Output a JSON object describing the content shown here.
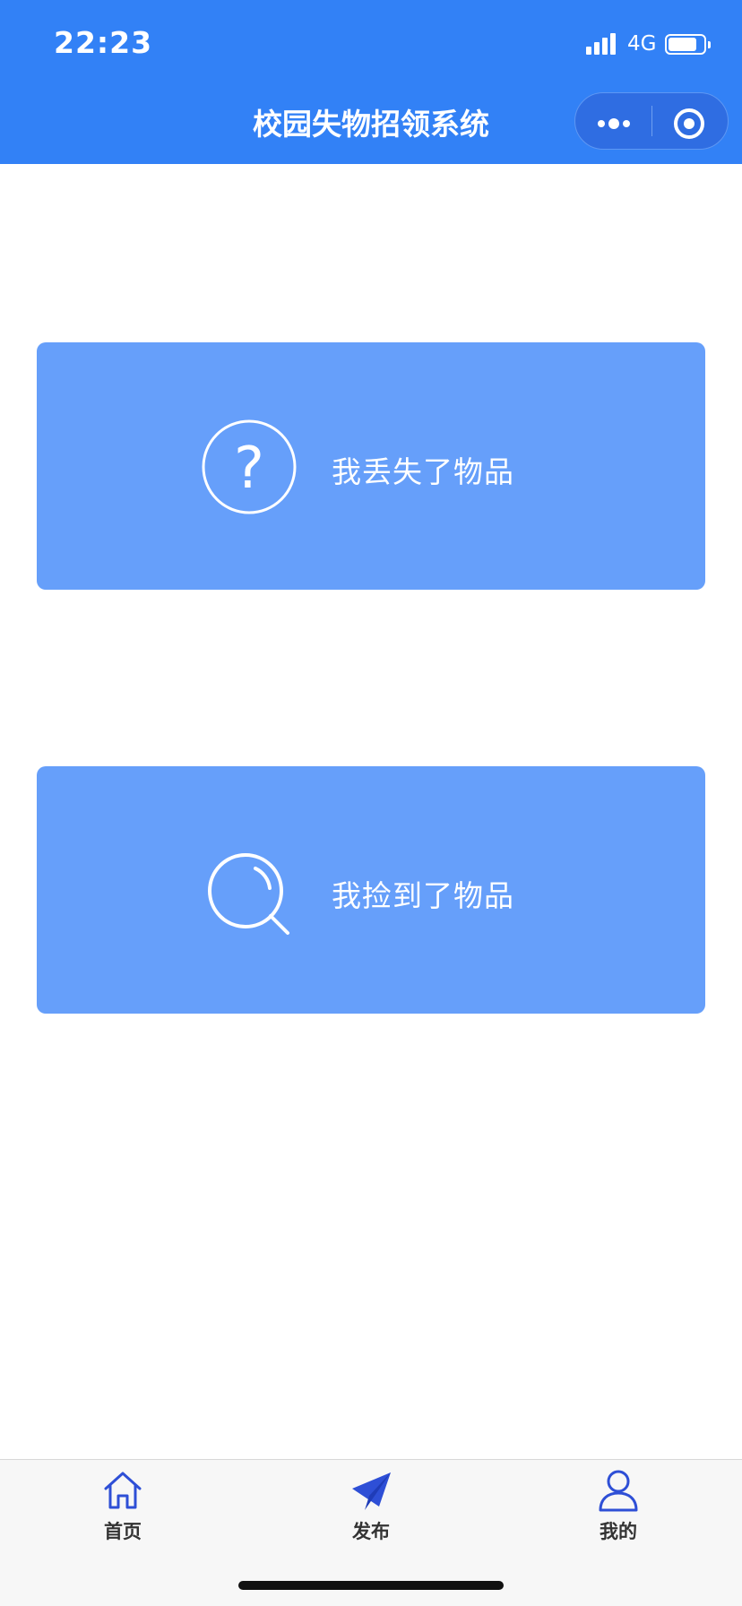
{
  "status_bar": {
    "time": "22:23",
    "network": "4G",
    "icons": [
      "signal-icon",
      "battery-icon"
    ]
  },
  "nav": {
    "title": "校园失物招领系统",
    "capsule": {
      "more_icon": "more-dots-icon",
      "close_icon": "target-close-icon"
    }
  },
  "cards": [
    {
      "label": "我丢失了物品",
      "icon": "question-circle-icon"
    },
    {
      "label": "我捡到了物品",
      "icon": "search-icon"
    }
  ],
  "tabbar": {
    "items": [
      {
        "label": "首页",
        "icon": "home-icon"
      },
      {
        "label": "发布",
        "icon": "paper-plane-icon"
      },
      {
        "label": "我的",
        "icon": "user-icon"
      }
    ]
  },
  "colors": {
    "header": "#3281f6",
    "card": "#669ffa",
    "tab_icon": "#2e4fd6"
  }
}
